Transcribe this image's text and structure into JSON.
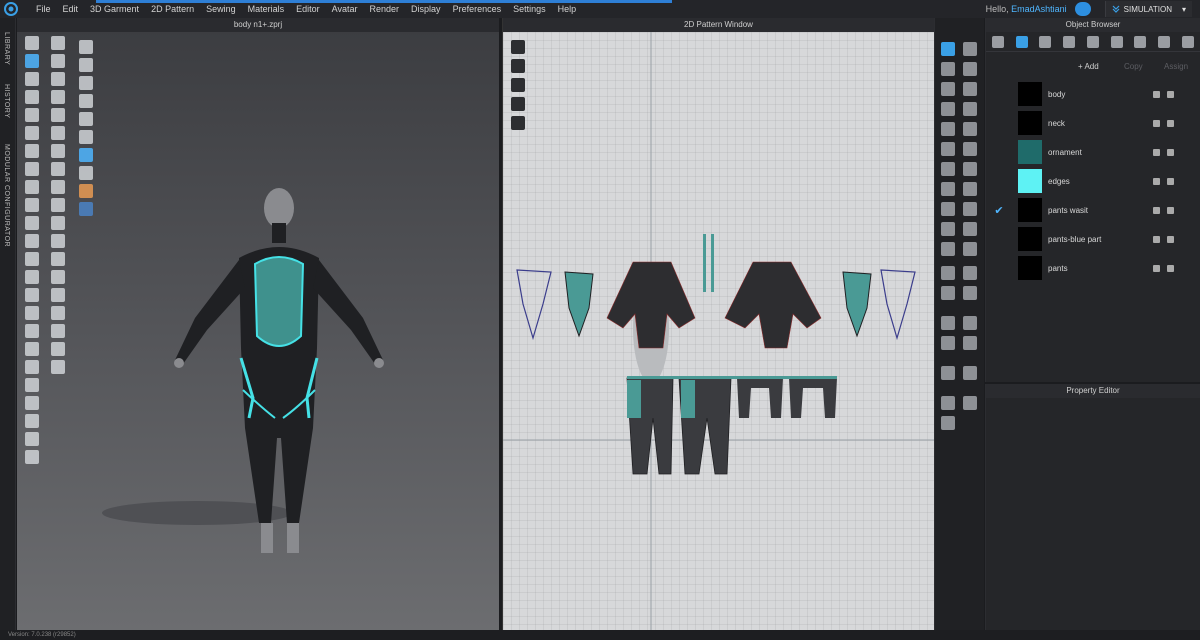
{
  "menubar": {
    "items": [
      "File",
      "Edit",
      "3D Garment",
      "2D Pattern",
      "Sewing",
      "Materials",
      "Editor",
      "Avatar",
      "Render",
      "Display",
      "Preferences",
      "Settings",
      "Help"
    ],
    "greeting": "Hello,",
    "username": "EmadAshtiani",
    "mode": "SIMULATION"
  },
  "left_rail": {
    "labels": [
      "LIBRARY",
      "HISTORY",
      "MODULAR CONFIGURATOR"
    ]
  },
  "viewport3d": {
    "title": "body n1+.zprj"
  },
  "pattern_window": {
    "title": "2D Pattern Window"
  },
  "object_browser": {
    "title": "Object Browser",
    "add_label": "+ Add",
    "copy_label": "Copy",
    "assign_label": "Assign",
    "fabrics": [
      {
        "name": "body",
        "color": "#000000",
        "checked": false
      },
      {
        "name": "neck",
        "color": "#000000",
        "checked": false
      },
      {
        "name": "ornament",
        "color": "#1f6b6a",
        "checked": false
      },
      {
        "name": "edges",
        "color": "#5ef2f4",
        "checked": false
      },
      {
        "name": "pants wasit",
        "color": "#000000",
        "checked": true
      },
      {
        "name": "pants-blue part",
        "color": "#000000",
        "checked": false
      },
      {
        "name": "pants",
        "color": "#000000",
        "checked": false
      }
    ]
  },
  "property_editor": {
    "title": "Property Editor"
  },
  "status_bar": {
    "text": "Version: 7.0.238 (r29852)"
  },
  "colors": {
    "accent": "#2e7fd6",
    "teal": "#4a9a95",
    "edge": "#45e1e6"
  }
}
